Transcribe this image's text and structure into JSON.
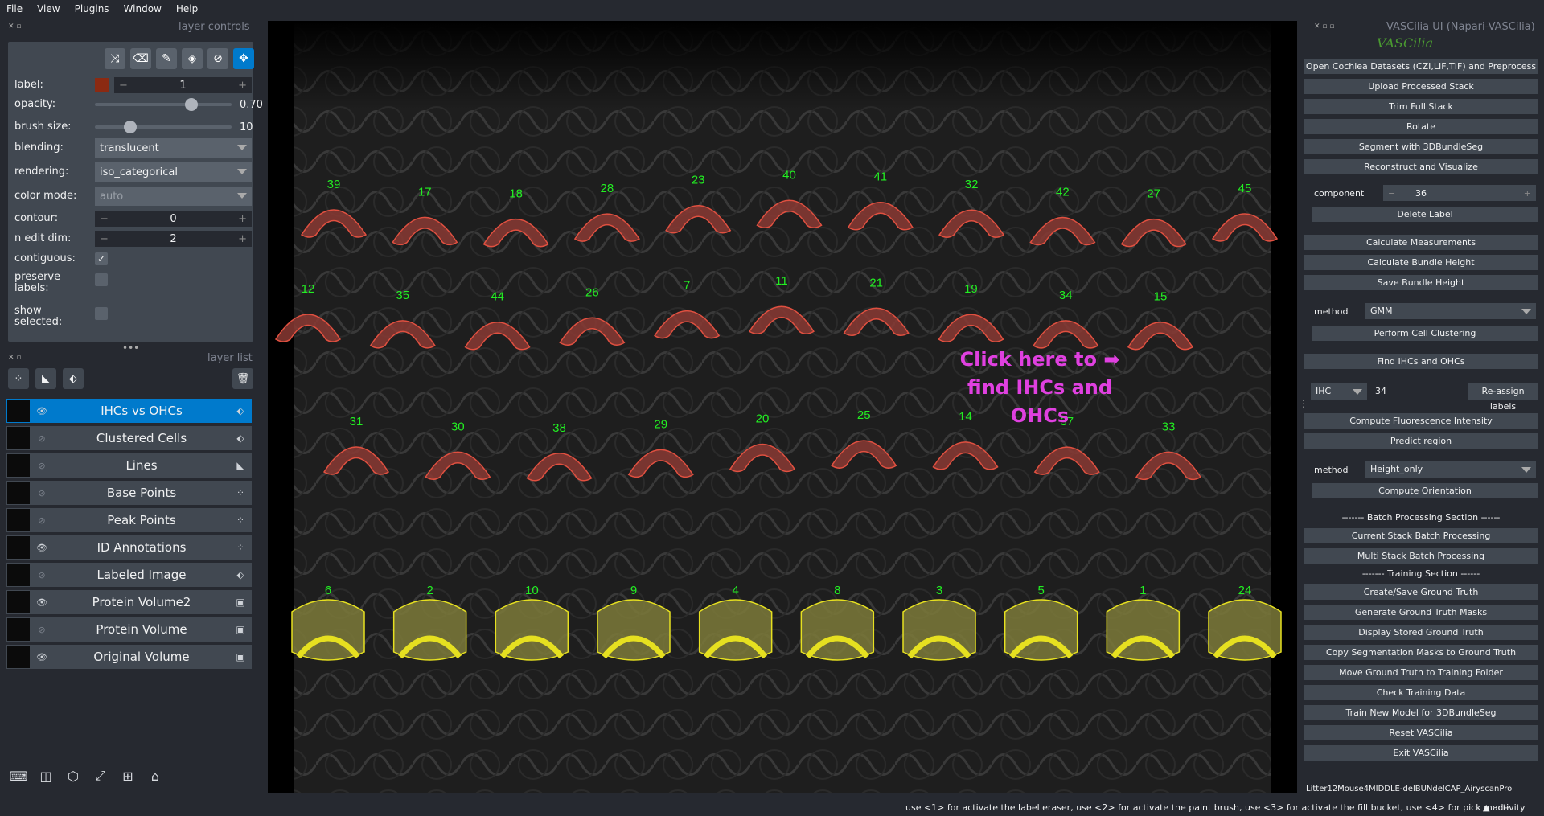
{
  "menu": [
    "File",
    "View",
    "Plugins",
    "Window",
    "Help"
  ],
  "layer_controls": {
    "title": "layer controls",
    "label_label": "label:",
    "label_value": "1",
    "opacity_label": "opacity:",
    "opacity_value": "0.70",
    "opacity_level": 0.7,
    "brush_label": "brush size:",
    "brush_value": "10",
    "brush_level": 0.2,
    "blending_label": "blending:",
    "blending_value": "translucent",
    "rendering_label": "rendering:",
    "rendering_value": "iso_categorical",
    "colormode_label": "color mode:",
    "colormode_value": "auto",
    "contour_label": "contour:",
    "contour_value": "0",
    "nedit_label": "n edit dim:",
    "nedit_value": "2",
    "contiguous_label": "contiguous:",
    "preserve_label": "preserve labels:",
    "show_label": "show selected:",
    "label_color": "#8b2a12"
  },
  "layer_list": {
    "title": "layer list",
    "layers": [
      {
        "name": "IHCs vs OHCs",
        "visible": true,
        "type": "label-icon"
      },
      {
        "name": "Clustered Cells",
        "visible": false,
        "type": "label-icon"
      },
      {
        "name": "Lines",
        "visible": false,
        "type": "shapes-icon"
      },
      {
        "name": "Base Points",
        "visible": false,
        "type": "points-icon"
      },
      {
        "name": "Peak Points",
        "visible": false,
        "type": "points-icon"
      },
      {
        "name": "ID Annotations",
        "visible": true,
        "type": "points-icon"
      },
      {
        "name": "Labeled Image",
        "visible": false,
        "type": "label-icon"
      },
      {
        "name": "Protein Volume2",
        "visible": true,
        "type": "image-icon"
      },
      {
        "name": "Protein Volume",
        "visible": false,
        "type": "image-icon"
      },
      {
        "name": "Original Volume",
        "visible": true,
        "type": "image-icon"
      }
    ]
  },
  "canvas": {
    "annotation_text_1": "Click here to ➡",
    "annotation_text_2": "find IHCs and",
    "annotation_text_3": "OHCs",
    "ohc_row1": [
      "39",
      "17",
      "18",
      "28",
      "23",
      "40",
      "41",
      "32",
      "42",
      "27",
      "45"
    ],
    "ohc_row2": [
      "12",
      "35",
      "44",
      "26",
      "7",
      "11",
      "21",
      "19",
      "34",
      "15"
    ],
    "ohc_row3": [
      "31",
      "30",
      "38",
      "29",
      "20",
      "25",
      "14",
      "37",
      "33"
    ],
    "ihc_row": [
      "6",
      "2",
      "10",
      "9",
      "4",
      "8",
      "3",
      "5",
      "1",
      "24"
    ],
    "ohc_color": "#8a3a34",
    "ihc_color": "#e6e020",
    "id_color": "#22ee22",
    "annotation_color": "#e040e0"
  },
  "right_panel": {
    "title": "VASCilia UI (Napari-VASCilia)",
    "logo": "VASCilia",
    "btn_open": "Open Cochlea Datasets (CZI,LIF,TIF) and Preprocess",
    "btn_upload": "Upload Processed Stack",
    "btn_trim": "Trim Full Stack",
    "btn_rotate": "Rotate",
    "btn_segment": "Segment with 3DBundleSeg",
    "btn_reconstruct": "Reconstruct and Visualize",
    "component_label": "component",
    "component_value": "36",
    "btn_delete": "Delete Label",
    "btn_calc_meas": "Calculate Measurements",
    "btn_calc_height": "Calculate Bundle Height",
    "btn_save_height": "Save Bundle Height",
    "method_label": "method",
    "method_value": "GMM",
    "btn_cluster": "Perform Cell Clustering",
    "btn_find": "Find IHCs and OHCs",
    "ihc_select": "IHC",
    "ihc_input": "34",
    "btn_reassign": "Re-assign labels",
    "btn_fluor": "Compute Fluorescence Intensity",
    "btn_predict": "Predict region",
    "method2_label": "method",
    "method2_value": "Height_only",
    "btn_orient": "Compute Orientation",
    "batch_section": "------- Batch Processing Section ------",
    "btn_current_batch": "Current Stack Batch Processing",
    "btn_multi_batch": "Multi Stack Batch Processing",
    "training_section": "------- Training Section ------",
    "btn_create_gt": "Create/Save Ground Truth",
    "btn_gen_gt": "Generate Ground Truth Masks",
    "btn_display_gt": "Display Stored Ground Truth",
    "btn_copy_seg": "Copy Segmentation Masks to Ground Truth",
    "btn_move_gt": "Move Ground Truth to Training Folder",
    "btn_check": "Check Training Data",
    "btn_train": "Train New Model for 3DBundleSeg",
    "btn_reset": "Reset VASCilia",
    "btn_exit": "Exit VASCilia",
    "filename": "Litter12Mouse4MIDDLE-delBUNdelCAP_AiryscanPro"
  },
  "status": {
    "message": "use <1> for activate the label eraser, use <2> for activate the paint brush, use <3> for activate the fill bucket, use <4> for pick mode",
    "activity": "activity"
  }
}
